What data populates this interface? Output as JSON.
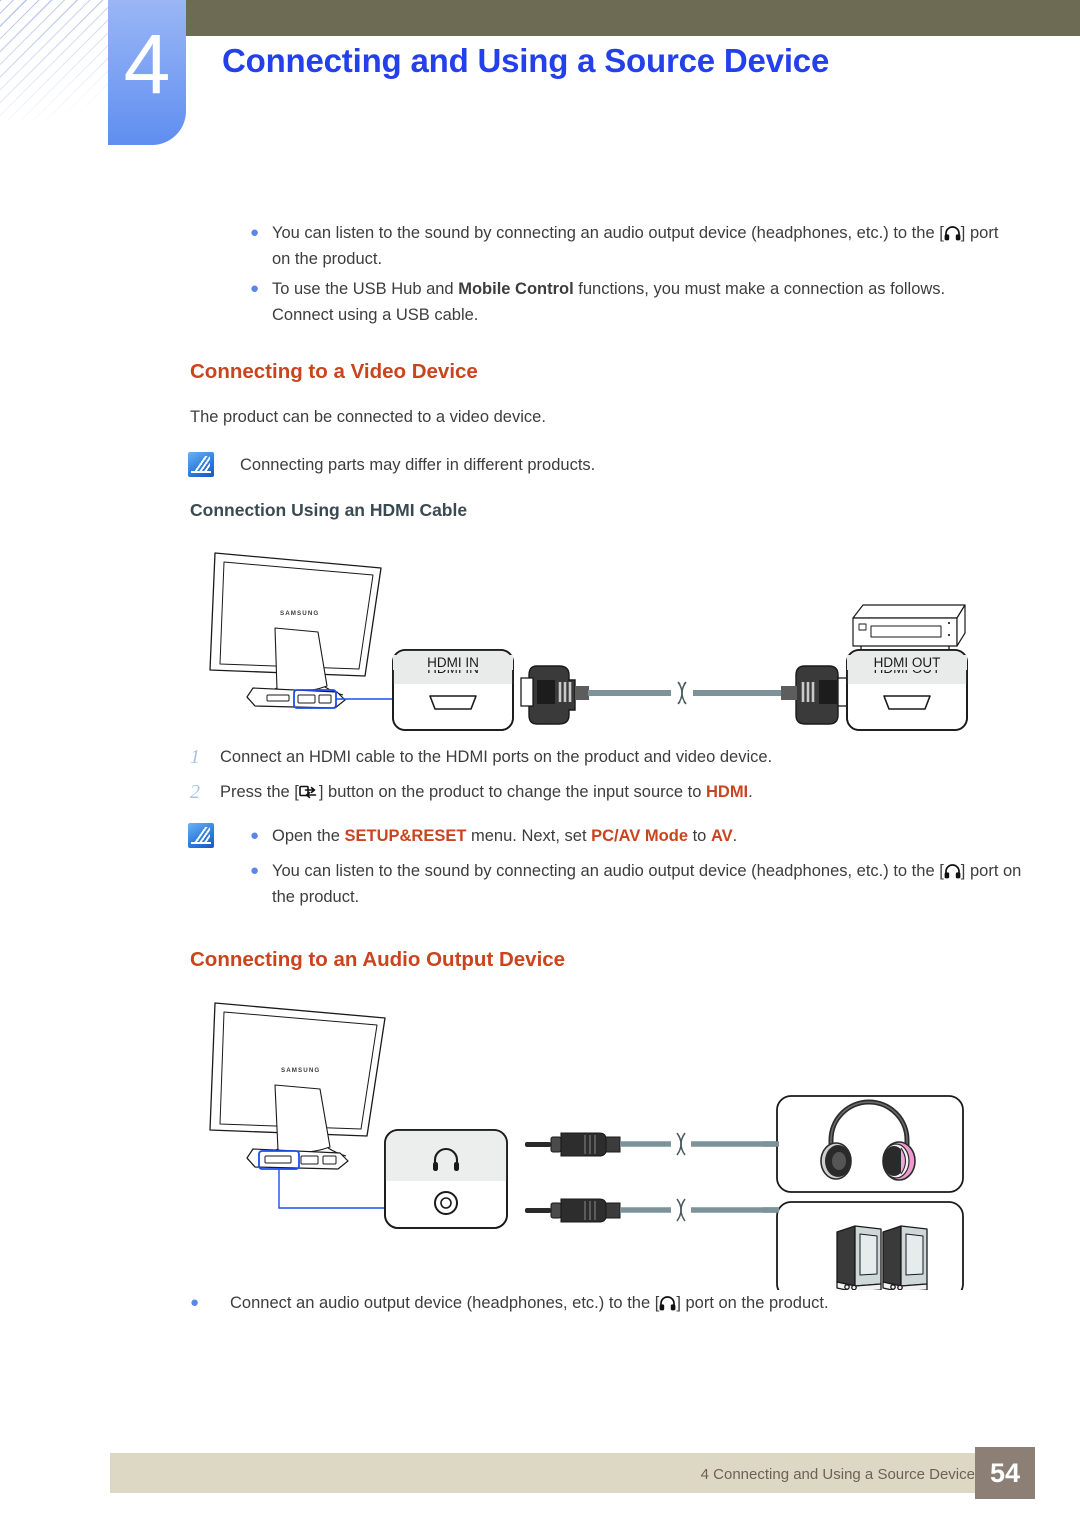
{
  "header": {
    "chapter_number": "4",
    "title": "Connecting and Using a Source Device"
  },
  "top_bullets": [
    {
      "pre": "You can listen to the sound by connecting an audio output device (headphones, etc.) to the [",
      "icon": "headphone-icon",
      "post": "] port on the product."
    },
    {
      "pre": "To use the USB Hub and ",
      "bold": "Mobile Control",
      "post": " functions, you must make a connection as follows. Connect using a USB cable."
    }
  ],
  "video_section": {
    "heading": "Connecting to a Video Device",
    "intro": "The product can be connected to a video device.",
    "note": "Connecting parts may differ in different products.",
    "subheading": "Connection Using an HDMI Cable",
    "diagram": {
      "monitor_brand": "SAMSUNG",
      "port_in_label": "HDMI IN",
      "port_out_label": "HDMI OUT"
    },
    "steps": [
      {
        "num": "1",
        "text": "Connect an HDMI cable to the HDMI ports on the product and video device."
      },
      {
        "num": "2",
        "pre": "Press the [",
        "icon": "source-button-icon",
        "mid": "] button on the product to change the input source to ",
        "highlight": "HDMI",
        "post": "."
      }
    ],
    "notes": [
      {
        "pre": "Open the ",
        "h1": "SETUP&RESET",
        "mid": " menu. Next, set ",
        "h2": "PC/AV Mode",
        "mid2": " to ",
        "h3": "AV",
        "post": "."
      },
      {
        "pre": "You can listen to the sound by connecting an audio output device (headphones, etc.) to the [",
        "icon": "headphone-icon",
        "post": "] port on the product."
      }
    ]
  },
  "audio_section": {
    "heading": "Connecting to an Audio Output Device",
    "diagram": {
      "monitor_brand": "SAMSUNG",
      "port_icon": "headphone-icon",
      "device_1": "headphones-image",
      "device_2": "speakers-image"
    },
    "bullet": {
      "pre": "Connect an audio output device (headphones, etc.) to the [",
      "icon": "headphone-icon",
      "post": "] port on the product."
    }
  },
  "footer": {
    "text": "4 Connecting and Using a Source Device",
    "page_number": "54"
  },
  "colors": {
    "title_blue": "#2340ea",
    "heading_orange": "#c8451e",
    "olive_bar": "#6e6b55",
    "tab_blue": "#6f9bf2",
    "footer_bar": "#ddd8c4",
    "footer_page_box": "#8c7f76",
    "bullet_blue": "#5b86e8",
    "callout_line": "#2c5ce0"
  }
}
